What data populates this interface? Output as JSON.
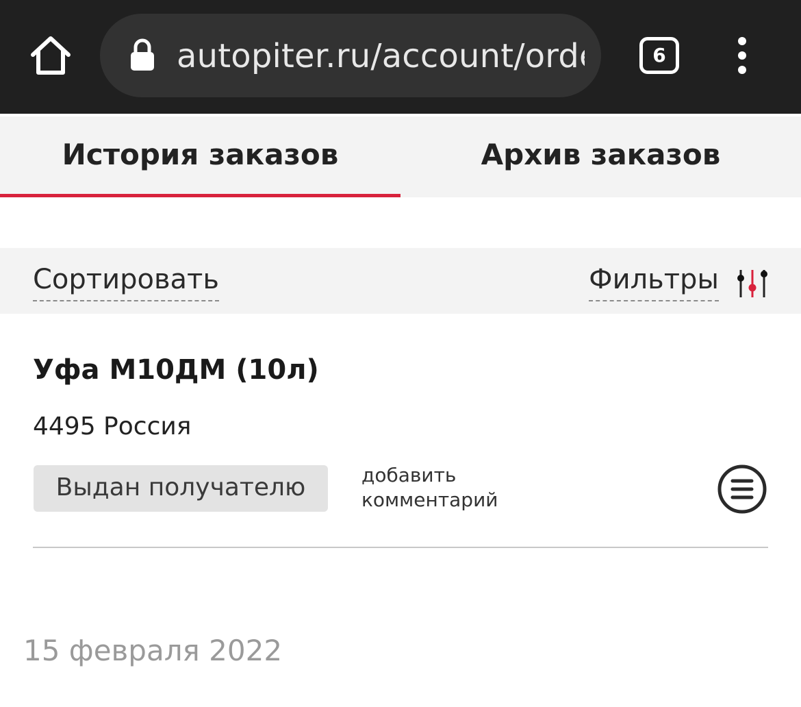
{
  "browser": {
    "url": "autopiter.ru/account/orders",
    "tab_count": "6",
    "colors": {
      "toolbar": "#202020",
      "url_pill": "#323232"
    }
  },
  "tabs": [
    {
      "label": "История заказов",
      "active": true
    },
    {
      "label": "Архив заказов",
      "active": false
    }
  ],
  "toolbar": {
    "sort_label": "Сортировать",
    "filter_label": "Фильтры",
    "filter_icon": "sliders-icon"
  },
  "order": {
    "title": "Уфа М10ДМ (10л)",
    "meta": "4495 Россия",
    "status": "Выдан получателю",
    "comment_link": "добавить комментарий",
    "menu_icon": "list-circle-icon"
  },
  "date_group": "15 февраля 2022",
  "colors": {
    "accent": "#d8223c",
    "tab_bg": "#f3f3f3",
    "badge_bg": "#e3e3e3",
    "date_text": "#9a9a9a"
  }
}
